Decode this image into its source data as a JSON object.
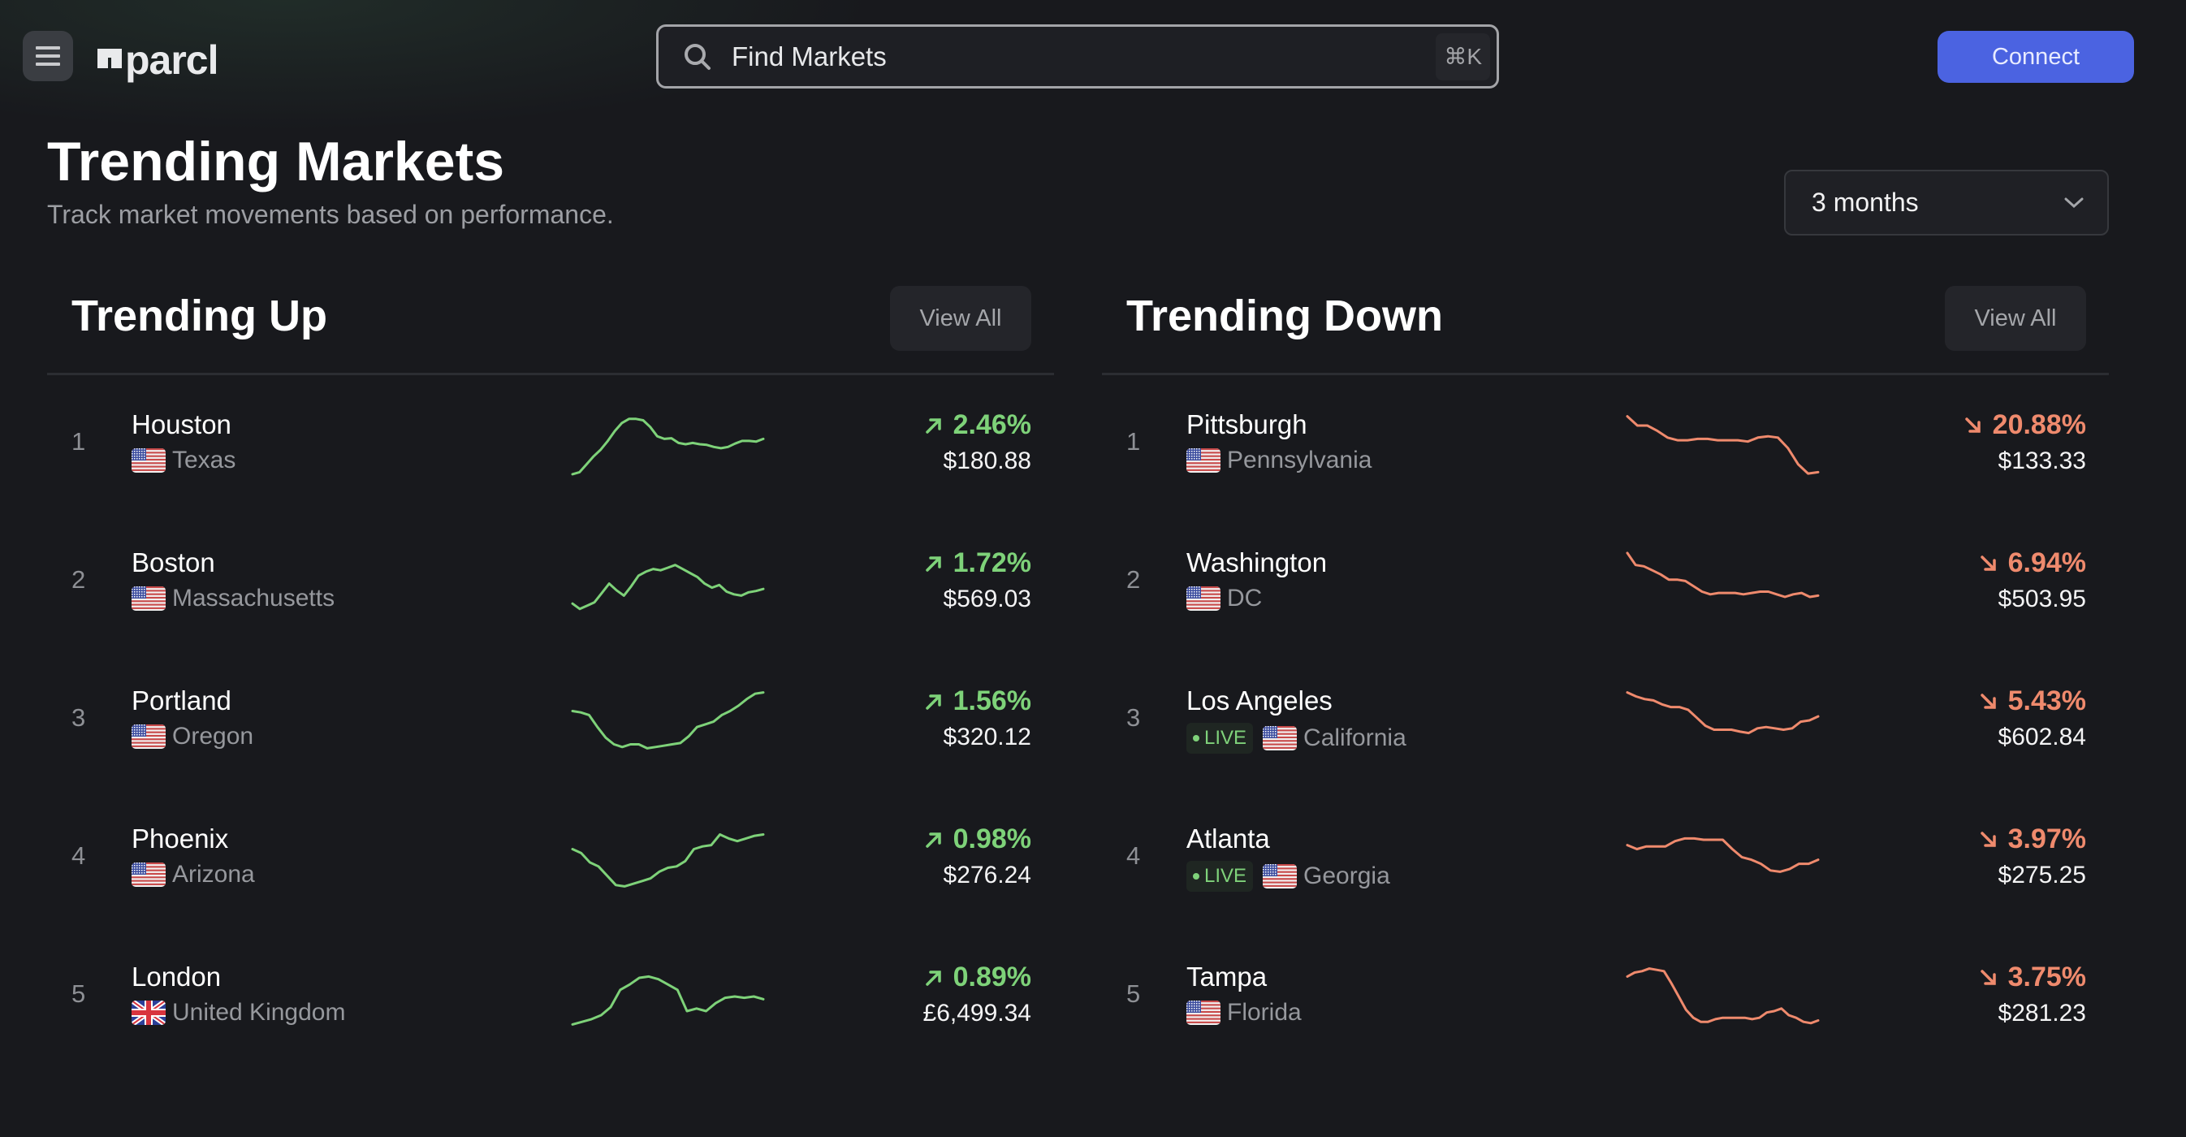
{
  "header": {
    "menu_icon": "hamburger-menu-icon",
    "logo_text": "parcl",
    "search": {
      "placeholder": "Find Markets",
      "value": "",
      "shortcut": "⌘K",
      "icon": "search-icon"
    },
    "connect_label": "Connect"
  },
  "page": {
    "title": "Trending Markets",
    "subtitle": "Track market movements based on performance.",
    "range_select": {
      "selected": "3 months",
      "icon": "chevron-down-icon"
    }
  },
  "colors": {
    "up": "#7ed279",
    "down": "#ef8a6d",
    "accent": "#4b63e1",
    "background": "#18191d"
  },
  "trending_up": {
    "title": "Trending Up",
    "view_all_label": "View All",
    "rows": [
      {
        "rank": "1",
        "city": "Houston",
        "region": "Texas",
        "flag": "us",
        "live": false,
        "change": "2.46%",
        "price": "$180.88",
        "spark": [
          5,
          8,
          20,
          32,
          42,
          55,
          70,
          82,
          88,
          88,
          86,
          76,
          62,
          58,
          59,
          52,
          50,
          52,
          50,
          49,
          46,
          44,
          46,
          51,
          55,
          55,
          54,
          58
        ]
      },
      {
        "rank": "2",
        "city": "Boston",
        "region": "Massachusetts",
        "flag": "us",
        "live": false,
        "change": "1.72%",
        "price": "$569.03",
        "spark": [
          18,
          10,
          15,
          20,
          34,
          48,
          38,
          30,
          44,
          60,
          66,
          70,
          68,
          72,
          76,
          70,
          64,
          58,
          48,
          42,
          46,
          36,
          32,
          30,
          35,
          37,
          40
        ]
      },
      {
        "rank": "3",
        "city": "Portland",
        "region": "Oregon",
        "flag": "us",
        "live": false,
        "change": "1.56%",
        "price": "$320.12",
        "spark": [
          64,
          62,
          58,
          40,
          24,
          14,
          10,
          14,
          14,
          8,
          10,
          12,
          14,
          16,
          26,
          40,
          44,
          48,
          58,
          64,
          72,
          82,
          90,
          92
        ]
      },
      {
        "rank": "4",
        "city": "Phoenix",
        "region": "Arizona",
        "flag": "us",
        "live": false,
        "change": "0.98%",
        "price": "$276.24",
        "spark": [
          64,
          58,
          44,
          38,
          24,
          10,
          8,
          12,
          16,
          20,
          30,
          36,
          38,
          46,
          64,
          68,
          70,
          86,
          80,
          76,
          80,
          84,
          86
        ]
      },
      {
        "rank": "5",
        "city": "London",
        "region": "United Kingdom",
        "flag": "uk",
        "live": false,
        "change": "0.89%",
        "price": "£6,499.34",
        "spark": [
          8,
          12,
          16,
          22,
          34,
          60,
          68,
          78,
          80,
          76,
          68,
          60,
          28,
          32,
          28,
          40,
          48,
          50,
          48,
          50,
          46
        ]
      }
    ]
  },
  "trending_down": {
    "title": "Trending Down",
    "view_all_label": "View All",
    "rows": [
      {
        "rank": "1",
        "city": "Pittsburgh",
        "region": "Pennsylvania",
        "flag": "us",
        "live": false,
        "change": "20.88%",
        "price": "$133.33",
        "spark": [
          92,
          78,
          78,
          70,
          60,
          56,
          56,
          58,
          58,
          56,
          56,
          56,
          54,
          60,
          62,
          60,
          44,
          20,
          6,
          8
        ]
      },
      {
        "rank": "2",
        "city": "Washington",
        "region": "DC",
        "flag": "us",
        "live": false,
        "change": "6.94%",
        "price": "$503.95",
        "spark": [
          94,
          76,
          74,
          68,
          62,
          54,
          54,
          52,
          44,
          36,
          32,
          34,
          34,
          34,
          32,
          34,
          36,
          36,
          32,
          28,
          32,
          34,
          28,
          30
        ]
      },
      {
        "rank": "3",
        "city": "Los Angeles",
        "region": "California",
        "flag": "us",
        "live": true,
        "change": "5.43%",
        "price": "$602.84",
        "spark": [
          92,
          86,
          82,
          80,
          74,
          70,
          70,
          66,
          54,
          42,
          36,
          36,
          36,
          33,
          31,
          38,
          40,
          38,
          36,
          38,
          48,
          50,
          56
        ]
      },
      {
        "rank": "4",
        "city": "Atlanta",
        "region": "Georgia",
        "flag": "us",
        "live": true,
        "change": "3.97%",
        "price": "$275.25",
        "spark": [
          70,
          64,
          68,
          68,
          68,
          76,
          80,
          80,
          78,
          78,
          78,
          64,
          52,
          48,
          42,
          32,
          30,
          34,
          42,
          42,
          48
        ]
      },
      {
        "rank": "5",
        "city": "Tampa",
        "region": "Florida",
        "flag": "us",
        "live": false,
        "change": "3.75%",
        "price": "$281.23",
        "spark": [
          80,
          86,
          88,
          92,
          90,
          88,
          70,
          50,
          30,
          18,
          12,
          12,
          16,
          18,
          18,
          18,
          18,
          16,
          18,
          26,
          28,
          32,
          22,
          18,
          12,
          10,
          14
        ]
      }
    ]
  }
}
